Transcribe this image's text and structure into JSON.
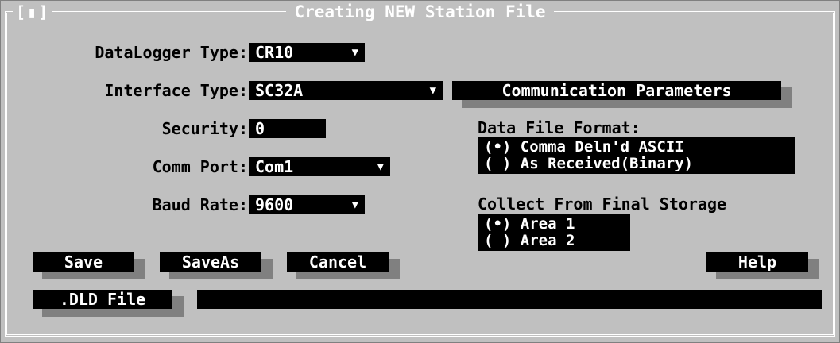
{
  "window": {
    "title": "Creating NEW Station File",
    "close_box": "[▮]"
  },
  "fields": {
    "datalogger_type": {
      "label": "DataLogger Type:",
      "value": "CR10"
    },
    "interface_type": {
      "label": "Interface Type:",
      "value": "SC32A"
    },
    "security": {
      "label": "Security:",
      "value": "0"
    },
    "comm_port": {
      "label": "Comm Port:",
      "value": "Com1"
    },
    "baud_rate": {
      "label": "Baud Rate:",
      "value": "9600"
    }
  },
  "dropdown_arrow": "▼",
  "buttons": {
    "comm_params": "Communication Parameters",
    "save": "Save",
    "save_as": "SaveAs",
    "cancel": "Cancel",
    "help": "Help",
    "dld_file": ".DLD File"
  },
  "data_file_format": {
    "title": "Data File Format:",
    "options": [
      {
        "label": "(•) Comma Deln'd ASCII",
        "selected": true
      },
      {
        "label": "( ) As Received(Binary)",
        "selected": false
      }
    ]
  },
  "collect_from": {
    "title": "Collect From Final Storage",
    "options": [
      {
        "label": "(•) Area 1",
        "selected": true
      },
      {
        "label": "( ) Area 2",
        "selected": false
      }
    ]
  },
  "dld_file_value": ""
}
